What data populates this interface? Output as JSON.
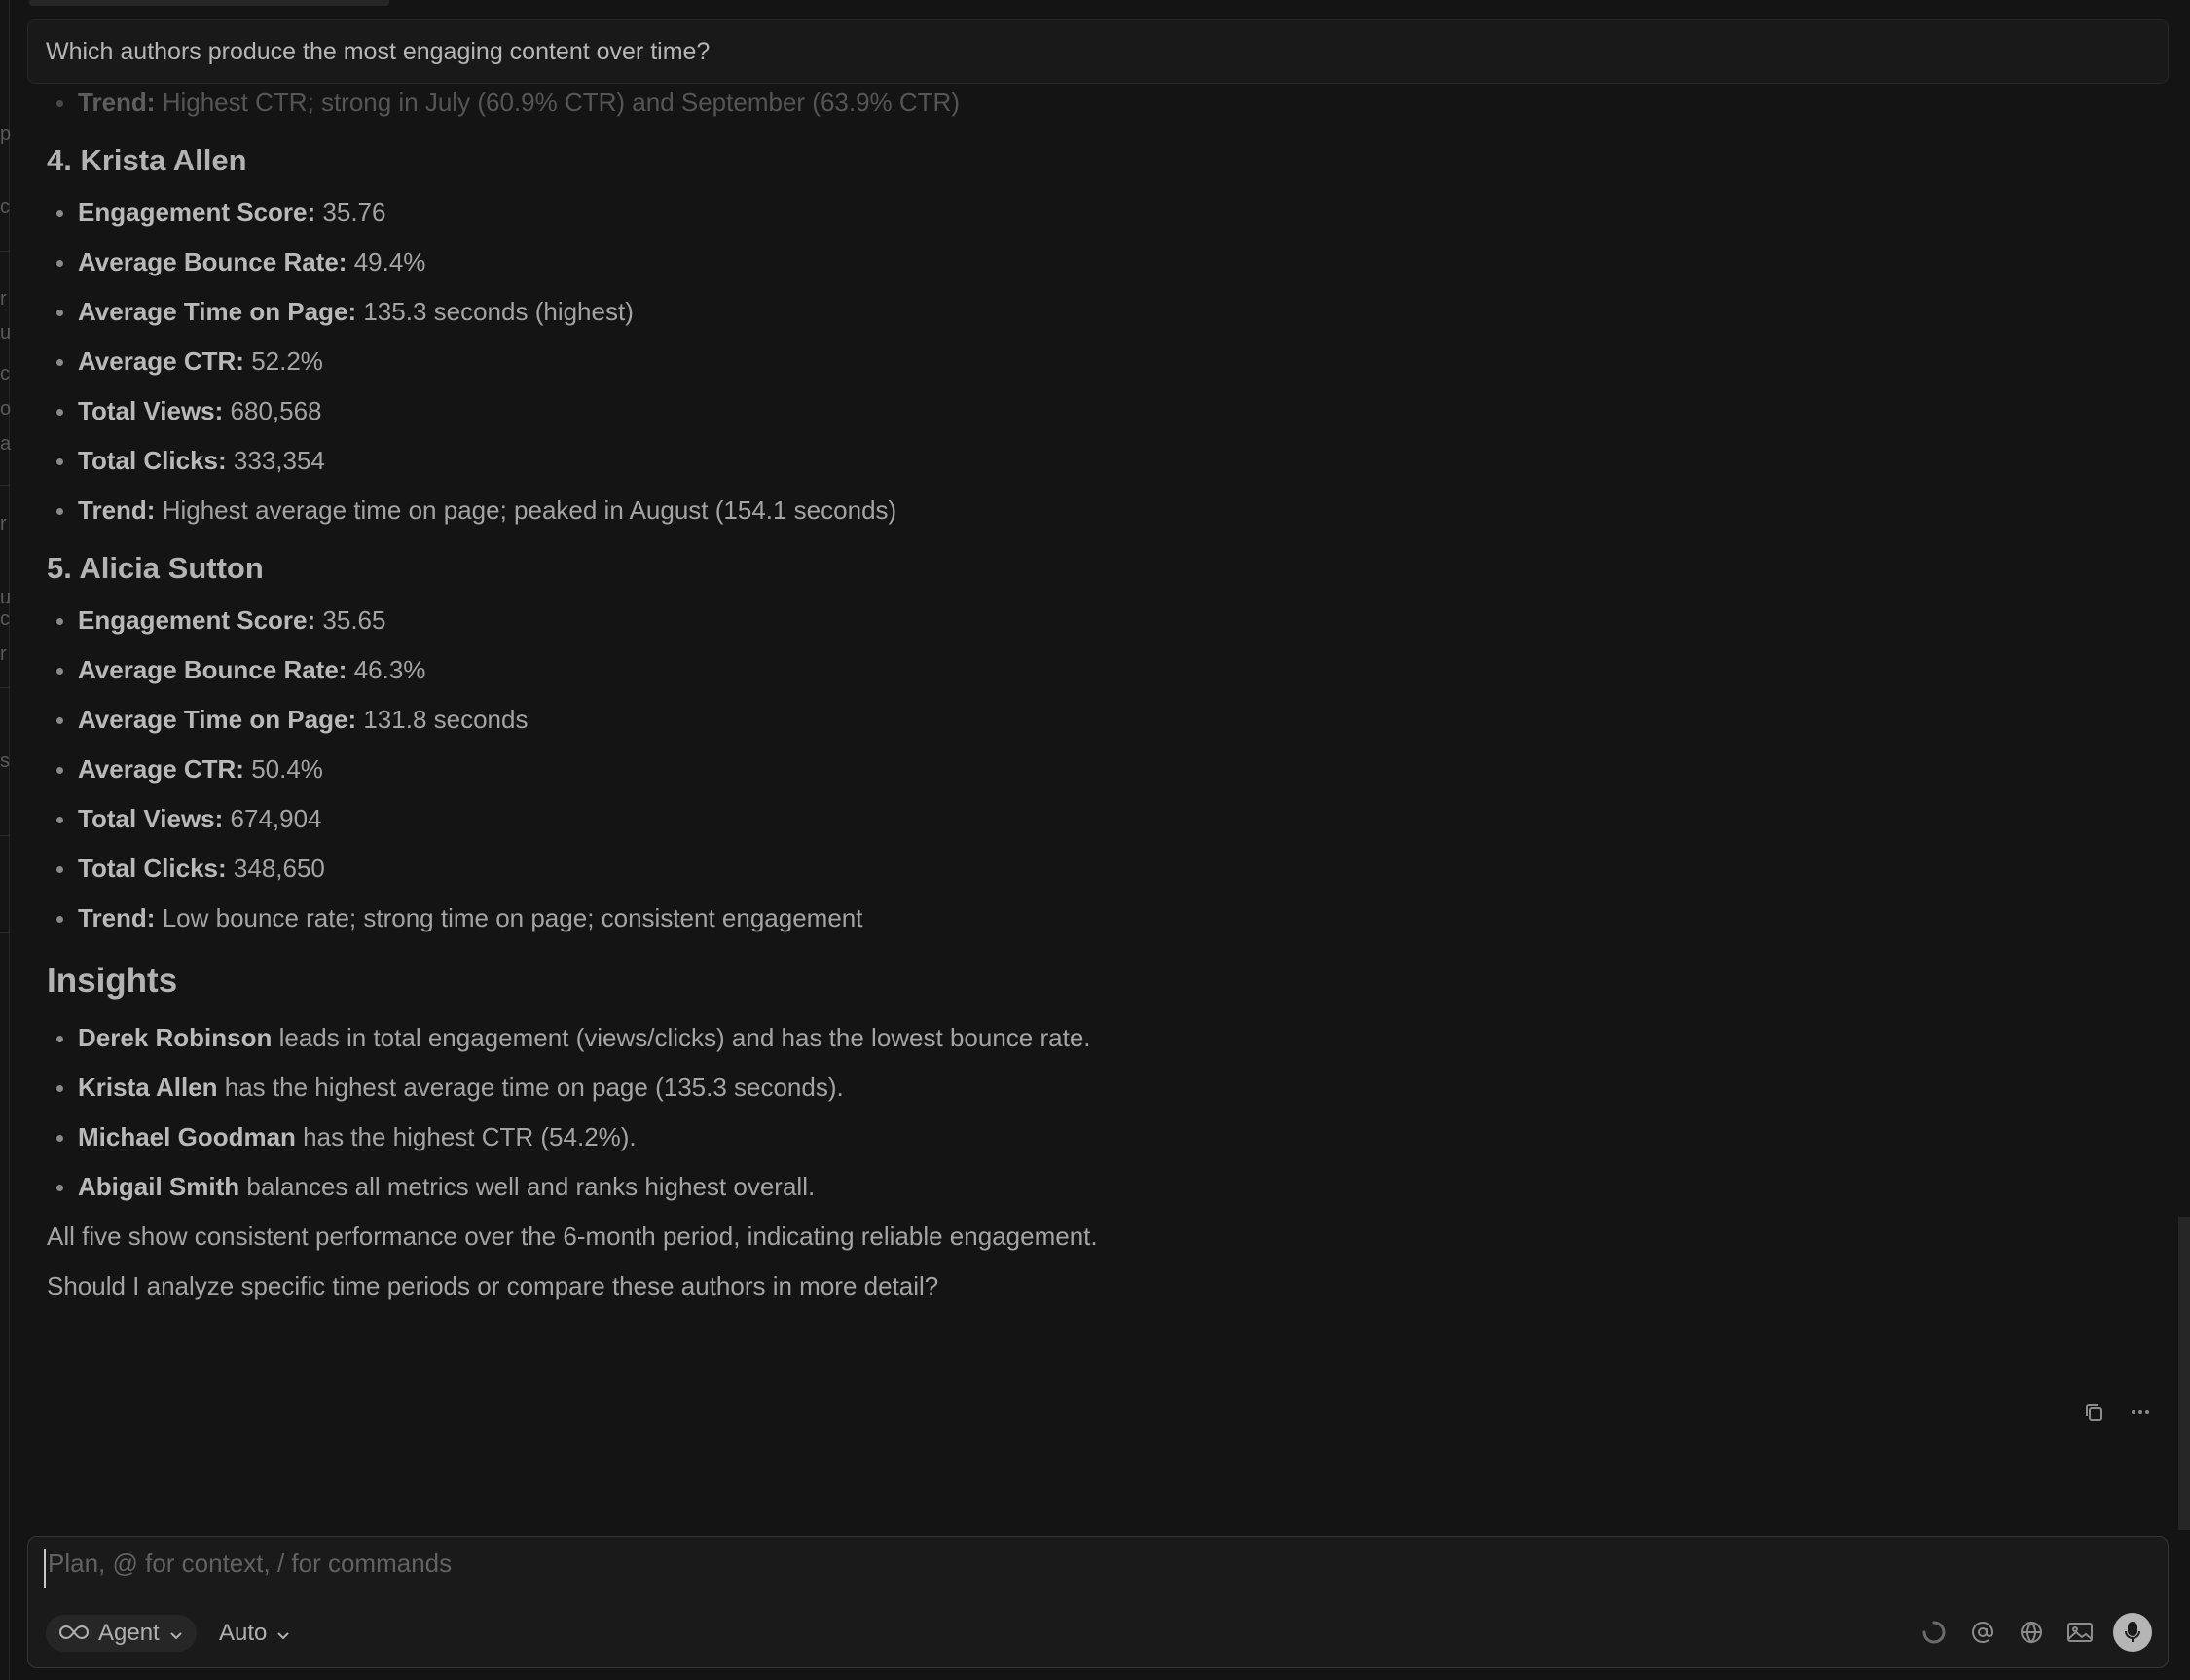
{
  "question": "Which authors produce the most engaging content over time?",
  "left_edge_chars": [
    "p",
    "c",
    "r",
    "u",
    "c",
    "o",
    "a",
    "r",
    "u",
    "c",
    "r",
    "s"
  ],
  "partial_trend": {
    "label": "Trend:",
    "text": "Highest CTR; strong in July (60.9% CTR) and September (63.9% CTR)"
  },
  "authors": [
    {
      "heading": "4. Krista Allen",
      "metrics": [
        {
          "label": "Engagement Score:",
          "value": "35.76"
        },
        {
          "label": "Average Bounce Rate:",
          "value": "49.4%"
        },
        {
          "label": "Average Time on Page:",
          "value": "135.3 seconds (highest)"
        },
        {
          "label": "Average CTR:",
          "value": "52.2%"
        },
        {
          "label": "Total Views:",
          "value": "680,568"
        },
        {
          "label": "Total Clicks:",
          "value": "333,354"
        },
        {
          "label": "Trend:",
          "value": "Highest average time on page; peaked in August (154.1 seconds)"
        }
      ]
    },
    {
      "heading": "5. Alicia Sutton",
      "metrics": [
        {
          "label": "Engagement Score:",
          "value": "35.65"
        },
        {
          "label": "Average Bounce Rate:",
          "value": "46.3%"
        },
        {
          "label": "Average Time on Page:",
          "value": "131.8 seconds"
        },
        {
          "label": "Average CTR:",
          "value": "50.4%"
        },
        {
          "label": "Total Views:",
          "value": "674,904"
        },
        {
          "label": "Total Clicks:",
          "value": "348,650"
        },
        {
          "label": "Trend:",
          "value": "Low bounce rate; strong time on page; consistent engagement"
        }
      ]
    }
  ],
  "insights": {
    "heading": "Insights",
    "items": [
      {
        "name": "Derek Robinson",
        "text": "leads in total engagement (views/clicks) and has the lowest bounce rate."
      },
      {
        "name": "Krista Allen",
        "text": "has the highest average time on page (135.3 seconds)."
      },
      {
        "name": "Michael Goodman",
        "text": "has the highest CTR (54.2%)."
      },
      {
        "name": "Abigail Smith",
        "text": "balances all metrics well and ranks highest overall."
      }
    ]
  },
  "summary": "All five show consistent performance over the 6-month period, indicating reliable engagement.",
  "followup": "Should I analyze specific time periods or compare these authors in more detail?",
  "composer": {
    "placeholder": "Plan, @ for context, / for commands",
    "mode_label": "Agent",
    "model_label": "Auto"
  },
  "icons": {
    "copy": "copy-icon",
    "more": "more-icon",
    "infinity": "infinity-icon",
    "loading": "loading-icon",
    "at": "at-icon",
    "globe": "globe-icon",
    "image": "image-icon",
    "mic": "microphone-icon"
  }
}
